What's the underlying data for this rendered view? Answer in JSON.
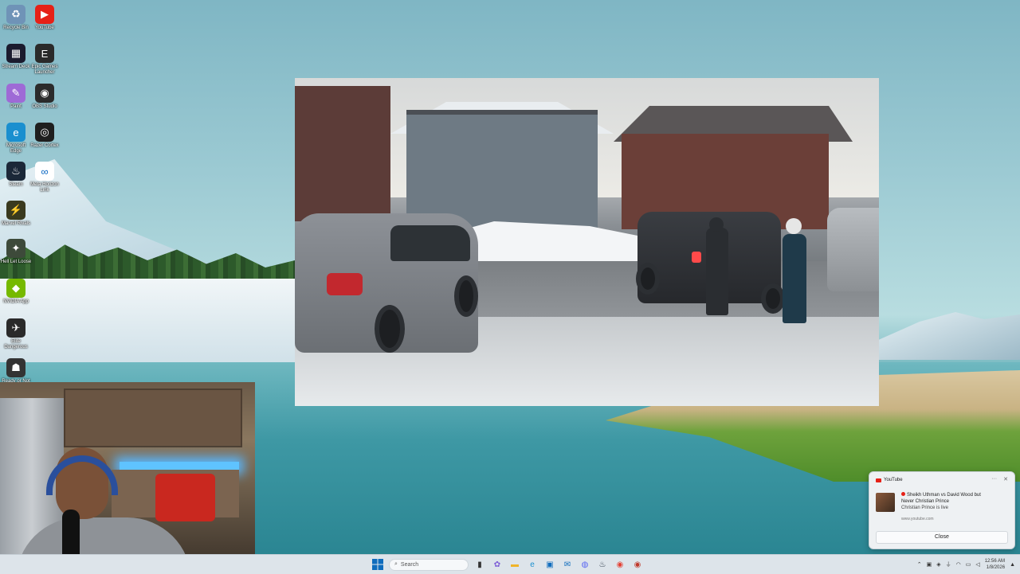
{
  "desktop": {
    "icons": [
      {
        "id": "recycle-bin",
        "label": "Recycle Bin",
        "glyph": "♻",
        "color": "#6f93b7"
      },
      {
        "id": "youtube",
        "label": "YouTube",
        "glyph": "▶",
        "color": "#e62117"
      },
      {
        "id": "streamdeck",
        "label": "Stream Deck",
        "glyph": "▦",
        "color": "#1b1b2e"
      },
      {
        "id": "epic-games",
        "label": "Epic Games Launcher",
        "glyph": "E",
        "color": "#2a2a2a"
      },
      {
        "id": "paint",
        "label": "Paint",
        "glyph": "✎",
        "color": "#9e6ad6"
      },
      {
        "id": "obs",
        "label": "OBS Studio",
        "glyph": "◉",
        "color": "#2b2b2b"
      },
      {
        "id": "edge",
        "label": "Microsoft Edge",
        "glyph": "e",
        "color": "#1a8fcf"
      },
      {
        "id": "razer-cortex",
        "label": "Razer Cortex",
        "glyph": "◎",
        "color": "#1f1f1f"
      },
      {
        "id": "steam",
        "label": "Steam",
        "glyph": "♨",
        "color": "#1b2838"
      },
      {
        "id": "meta-quest",
        "label": "Meta Horizon Link",
        "glyph": "∞",
        "color": "#ffffff"
      },
      {
        "id": "marvel-rivals",
        "label": "Marvel Rivals",
        "glyph": "⚡",
        "color": "#3a3a1f"
      },
      {
        "id": "hell-let-loose",
        "label": "Hell Let Loose",
        "glyph": "✦",
        "color": "#3d4a3a"
      },
      {
        "id": "nvidia",
        "label": "NVIDIA App",
        "glyph": "◆",
        "color": "#76b900"
      },
      {
        "id": "elite-dangerous",
        "label": "Elite Dangerous",
        "glyph": "✈",
        "color": "#2a2a2a"
      },
      {
        "id": "ready-or-not",
        "label": "Ready or Not",
        "glyph": "☗",
        "color": "#333333"
      }
    ]
  },
  "notification": {
    "app": "YouTube",
    "title_line1": "Sheikh Uthman vs David Wood but",
    "title_line2": "Never Christian Prince",
    "subtitle": "Christian Prince is live",
    "source": "www.youtube.com",
    "close_label": "Close",
    "more_glyph": "···",
    "dismiss_glyph": "✕"
  },
  "taskbar": {
    "search_placeholder": "Search",
    "apps": [
      {
        "id": "file-explorer-tb",
        "glyph": "▮",
        "color": "#333"
      },
      {
        "id": "copilot-tb",
        "glyph": "✿",
        "color": "#7b5cd6"
      },
      {
        "id": "folder-tb",
        "glyph": "▬",
        "color": "#f0b429"
      },
      {
        "id": "edge-tb",
        "glyph": "e",
        "color": "#1a8fcf"
      },
      {
        "id": "store-tb",
        "glyph": "▣",
        "color": "#0f6cbd"
      },
      {
        "id": "outlook-tb",
        "glyph": "✉",
        "color": "#0f6cbd"
      },
      {
        "id": "discord-tb",
        "glyph": "◍",
        "color": "#5865f2"
      },
      {
        "id": "steam-tb",
        "glyph": "♨",
        "color": "#1b2838"
      },
      {
        "id": "chrome-tb",
        "glyph": "◉",
        "color": "#e44134"
      },
      {
        "id": "obs-tb",
        "glyph": "◉",
        "color": "#c0392b"
      }
    ],
    "tray": {
      "chevron": "⌃",
      "time": "12:56 AM",
      "date": "1/8/2026"
    }
  }
}
